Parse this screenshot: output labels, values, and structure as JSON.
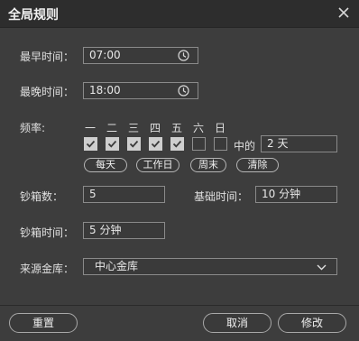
{
  "dialog": {
    "title": "全局规则",
    "close_glyph": "✕"
  },
  "form": {
    "earliest": {
      "label": "最早时间：",
      "value": "07:00"
    },
    "latest": {
      "label": "最晚时间：",
      "value": "18:00"
    },
    "frequency": {
      "label": "频率:",
      "weekdays": [
        "一",
        "二",
        "三",
        "四",
        "五",
        "六",
        "日"
      ],
      "checked": [
        true,
        true,
        true,
        true,
        true,
        false,
        false
      ],
      "middle_label": "中的",
      "middle_value": "2 天",
      "presets": [
        "每天",
        "工作日",
        "周末",
        "清除"
      ]
    },
    "count": {
      "label": "钞箱数：",
      "value": "5"
    },
    "base_time": {
      "label": "基础时间：",
      "value": "10 分钟"
    },
    "cash_time": {
      "label": "钞箱时间：",
      "value": "5 分钟"
    },
    "source": {
      "label": "来源金库：",
      "value": "中心金库"
    }
  },
  "footer": {
    "reset": "重置",
    "cancel": "取消",
    "modify": "修改"
  },
  "icons": {
    "clock": "clock-icon",
    "check": "check-icon",
    "chevron": "chevron-down-icon",
    "close": "close-icon"
  }
}
